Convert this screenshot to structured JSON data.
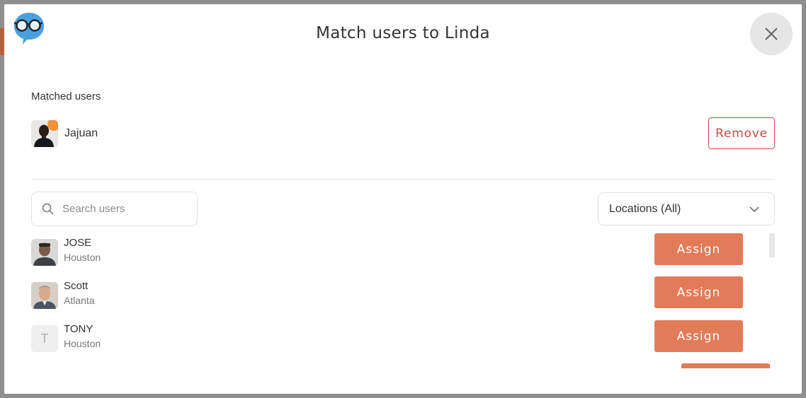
{
  "modal": {
    "title": "Match users to Linda",
    "close_icon": "close-icon",
    "logo_icon": "glasses-chat-bubble-icon"
  },
  "matched": {
    "section_label": "Matched users",
    "users": [
      {
        "name": "Jajuan",
        "avatar": "photo"
      }
    ],
    "remove_label": "Remove"
  },
  "filters": {
    "search_placeholder": "Search users",
    "search_value": "",
    "location_selected": "Locations (All)"
  },
  "users": [
    {
      "name": "JOSE",
      "location": "Houston",
      "avatar": "photo",
      "assign_label": "Assign"
    },
    {
      "name": "Scott",
      "location": "Atlanta",
      "avatar": "photo",
      "assign_label": "Assign"
    },
    {
      "name": "TONY",
      "location": "Houston",
      "avatar": "initial",
      "initial": "T",
      "assign_label": "Assign"
    }
  ],
  "colors": {
    "accent": "#e27b58",
    "danger": "#c94b4b",
    "logo": "#4a9fdf"
  }
}
